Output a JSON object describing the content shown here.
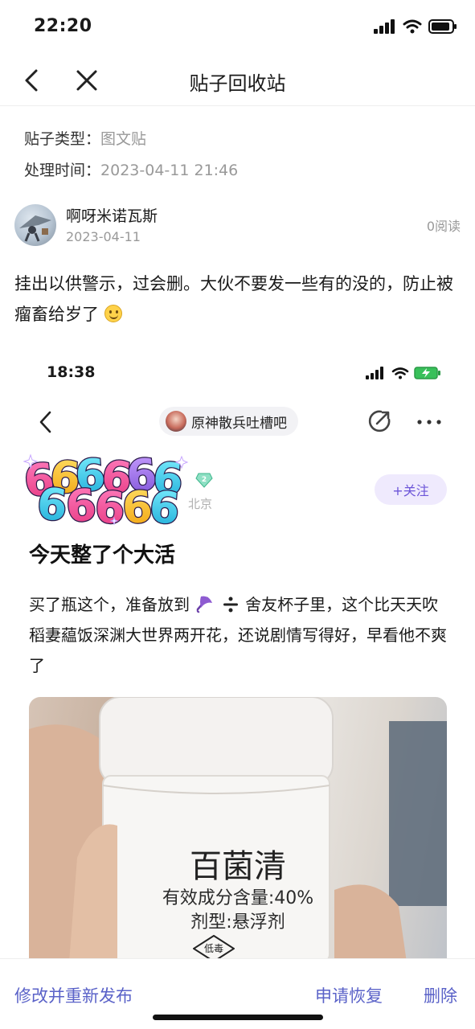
{
  "status_bar": {
    "time": "22:20"
  },
  "nav": {
    "title": "贴子回收站"
  },
  "meta": {
    "type_label": "贴子类型：",
    "type_value": "图文贴",
    "time_label": "处理时间：",
    "time_value": "2023-04-11 21:46"
  },
  "author": {
    "name": "啊呀米诺瓦斯",
    "date": "2023-04-11",
    "read_count": "0阅读"
  },
  "post": {
    "text": "挂出以供警示，过会删。大伙不要发一些有的没的，防止被瘤畜给岁了"
  },
  "embedded": {
    "time": "18:38",
    "forum_name": "原神散兵吐槽吧",
    "badge_text": "666666",
    "level": "2",
    "location": "北京",
    "follow_label": "+关注",
    "title": "今天整了个大活",
    "body_part1": "买了瓶这个，准备放到",
    "body_part2": "舍友杯子里，这个比天天吹稻妻藴饭深渊大世界两开花，还说剧情写得好，早看他不爽了",
    "photo_name": "百菌清",
    "photo_line2": "有效成分含量:40%",
    "photo_line3": "剂型:悬浮剂",
    "photo_stamp": "低毒"
  },
  "bottom": {
    "republish_label": "修改并重新发布",
    "restore_label": "申请恢复",
    "delete_label": "删除"
  },
  "colors": {
    "accent": "#5a62c8",
    "follow_bg": "#efeafd",
    "follow_text": "#6c55d8",
    "muted": "#999999"
  }
}
